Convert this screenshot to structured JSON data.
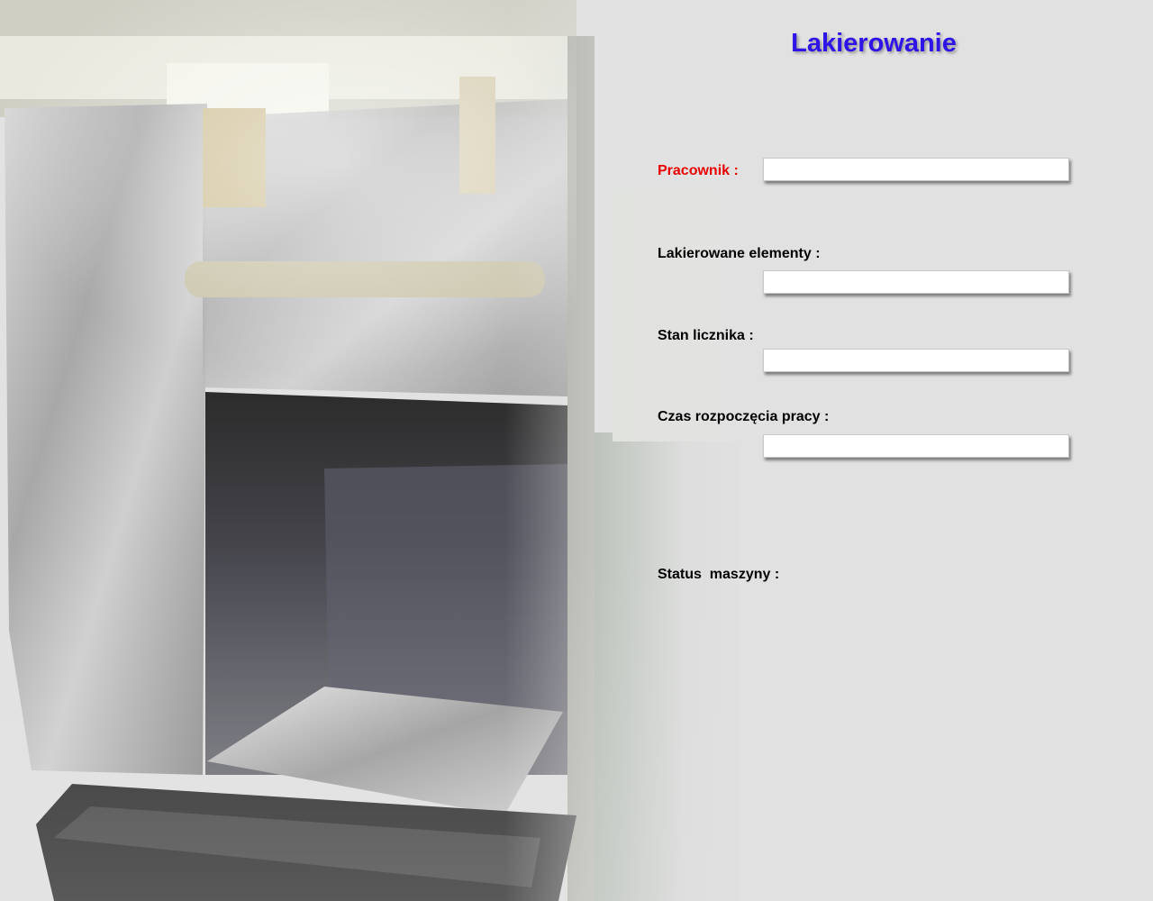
{
  "page": {
    "title": "Lakierowanie"
  },
  "form": {
    "worker_label": "Pracownik :",
    "worker_value": "",
    "elements_label": "Lakierowane elementy :",
    "elements_value": "",
    "counter_label": "Stan licznika :",
    "counter_value": "",
    "start_time_label": "Czas rozpoczęcia pracy :",
    "start_time_value": "",
    "status_label": "Status  maszyny :"
  },
  "colors": {
    "title": "#2e14e6",
    "worker_label": "#e80000",
    "label": "#000000"
  }
}
